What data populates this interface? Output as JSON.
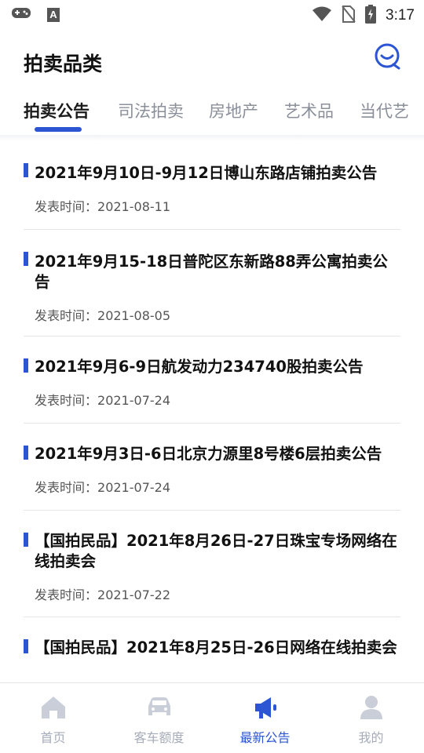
{
  "status_bar": {
    "time": "3:17",
    "notification_glyph": "A"
  },
  "header": {
    "title": "拍卖品类"
  },
  "tabs": [
    {
      "label": "拍卖公告",
      "active": true
    },
    {
      "label": "司法拍卖",
      "active": false
    },
    {
      "label": "房地产",
      "active": false
    },
    {
      "label": "艺术品",
      "active": false
    },
    {
      "label": "当代艺",
      "active": false
    }
  ],
  "list": {
    "date_prefix": "发表时间：",
    "items": [
      {
        "title": "2021年9月10日-9月12日博山东路店铺拍卖公告",
        "date": "2021-08-11"
      },
      {
        "title": "2021年9月15-18日普陀区东新路88弄公寓拍卖公告",
        "date": "2021-08-05"
      },
      {
        "title": "2021年9月6-9日航发动力234740股拍卖公告",
        "date": "2021-07-24"
      },
      {
        "title": "2021年9月3日-6日北京力源里8号楼6层拍卖公告",
        "date": "2021-07-24"
      },
      {
        "title": "【国拍民品】2021年8月26日-27日珠宝专场网络在线拍卖会",
        "date": "2021-07-22"
      },
      {
        "title": "【国拍民品】2021年8月25日-26日网络在线拍卖会",
        "date": ""
      }
    ]
  },
  "bottom_nav": [
    {
      "label": "首页",
      "icon": "home-icon",
      "active": false
    },
    {
      "label": "客车额度",
      "icon": "car-icon",
      "active": false
    },
    {
      "label": "最新公告",
      "icon": "megaphone-icon",
      "active": true
    },
    {
      "label": "我的",
      "icon": "person-icon",
      "active": false
    }
  ],
  "colors": {
    "accent": "#2c55d4",
    "inactive": "#a6acb8",
    "text": "#111111"
  }
}
